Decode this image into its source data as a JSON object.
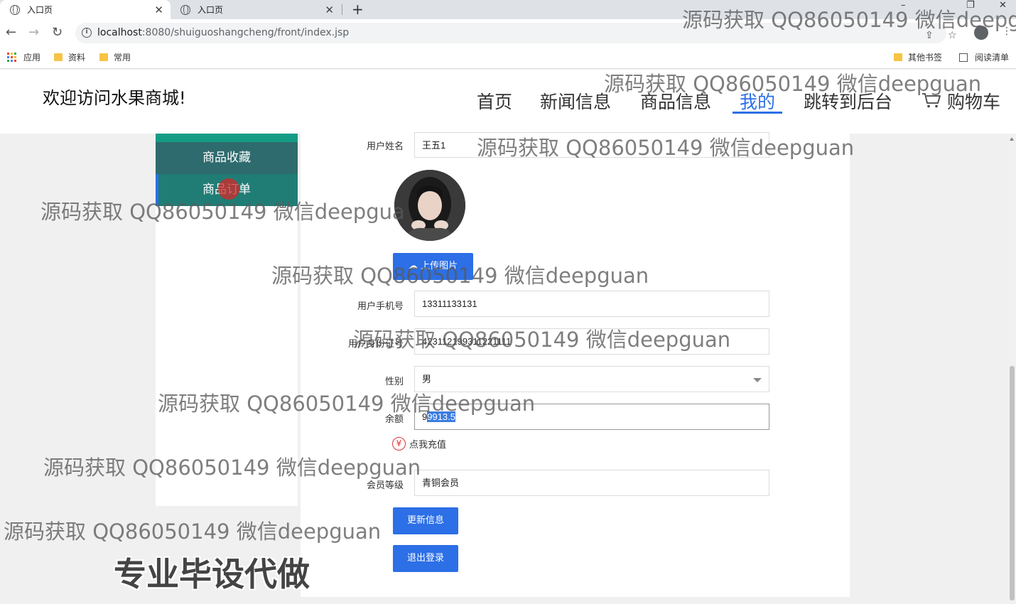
{
  "browser": {
    "tabs": [
      {
        "title": "入口页",
        "active": true
      },
      {
        "title": "入口页",
        "active": false
      }
    ],
    "url_host": "localhost",
    "url_rest": ":8080/shuiguoshangcheng/front/index.jsp",
    "bookmarks": {
      "left": [
        "应用",
        "资料",
        "常用"
      ],
      "other": "其他书签",
      "reading": "阅读清单"
    }
  },
  "header": {
    "welcome": "欢迎访问水果商城!",
    "nav": [
      "首页",
      "新闻信息",
      "商品信息",
      "我的",
      "跳转到后台",
      "购物车"
    ],
    "active_nav": "我的",
    "accent_color": "#2c6fe6"
  },
  "sidebar": {
    "items": [
      "商品收藏",
      "商品订单"
    ],
    "colors": {
      "fav": "#2e6b6e",
      "order": "#207d75",
      "top": "#169b85"
    }
  },
  "form": {
    "name_label": "用户姓名",
    "name_value": "王五1",
    "upload_button": "上传图片",
    "phone_label": "用户手机号",
    "phone_value": "13311133131",
    "id_label": "用户身份证号",
    "id_value": "423112199311221111",
    "gender_label": "性别",
    "gender_value": "男",
    "balance_label": "余额",
    "balance_value_first": "9",
    "balance_value_selected": "9913.5",
    "recharge_label": "点我充值",
    "level_label": "会员等级",
    "level_value": "青铜会员",
    "update_button": "更新信息",
    "logout_button": "退出登录"
  },
  "watermarks": {
    "text": "源码获取 QQ86050149 微信deepguan",
    "clipped": "源码获取 QQ86050149 微信deepg",
    "clipped_side": "源码获取 QQ86050149 微信deepgua",
    "ad": "专业毕设代做"
  }
}
